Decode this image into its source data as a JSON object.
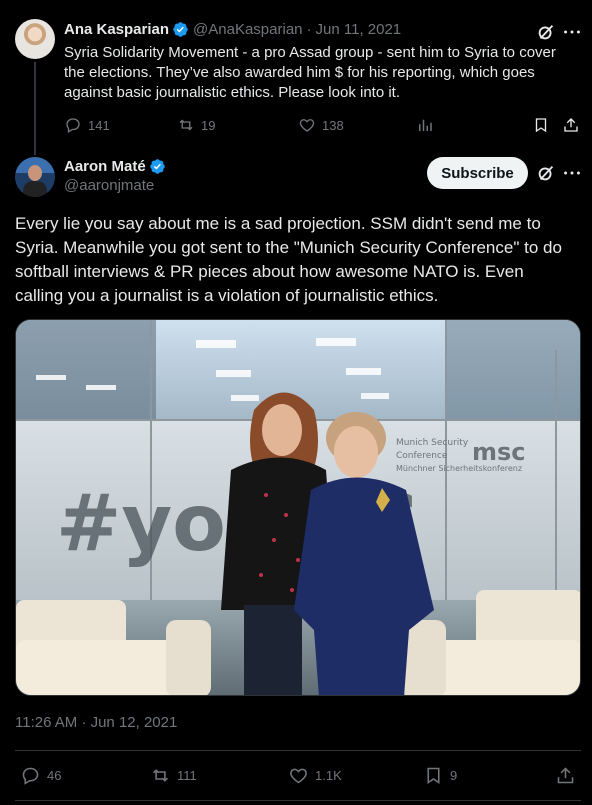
{
  "tweet1": {
    "author_name": "Ana Kasparian",
    "handle": "@AnaKasparian",
    "separator": "·",
    "date": "Jun 11, 2021",
    "text": "Syria Solidarity Movement - a pro Assad group - sent him to Syria to cover the elections. They’ve also awarded him $ for his reporting, which goes against basic journalistic ethics. Please look into it.",
    "replies": "141",
    "reposts": "19",
    "likes": "138"
  },
  "tweet2": {
    "author_name": "Aaron Maté",
    "handle": "@aaronjmate",
    "subscribe_label": "Subscribe",
    "text": "Every lie you say about me is a sad projection. SSM didn't send me to Syria. Meanwhile you got sent to the \"Munich Security Conference\" to do softball interviews & PR pieces about how awesome NATO is. Even calling you a journalist is a violation of journalistic ethics.",
    "photo": {
      "wall_text": "#yoMSC",
      "logo_line1": "Munich Security",
      "logo_line2": "Conference",
      "logo_line3": "Münchner Sicherheitskonferenz",
      "logo_mark": "msc"
    },
    "timestamp": "11:26 AM · Jun 12, 2021",
    "replies": "46",
    "reposts": "111",
    "likes": "1.1K",
    "bookmarks": "9"
  },
  "colors": {
    "background": "#000000",
    "text": "#e7e9ea",
    "muted": "#71767b",
    "verified": "#1d9bf0",
    "divider": "#2f3336"
  }
}
